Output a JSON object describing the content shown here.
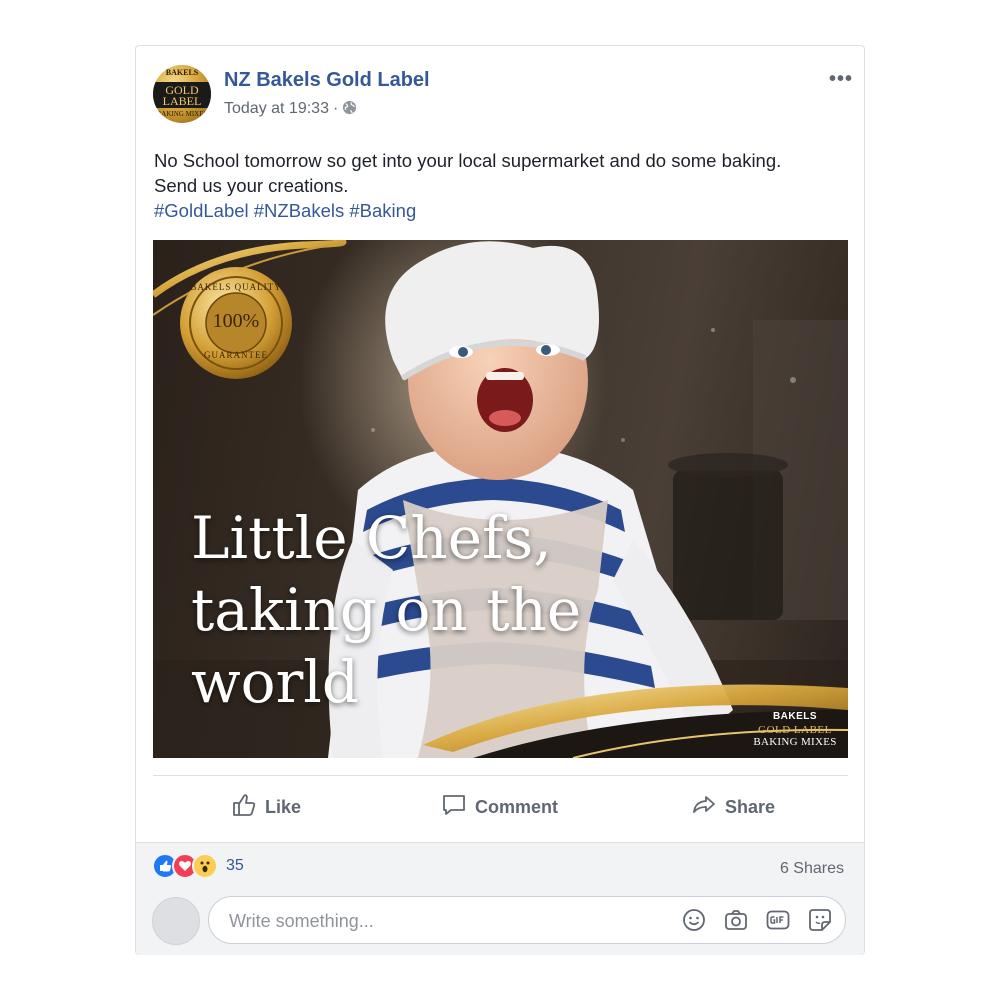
{
  "post": {
    "page_name": "NZ Bakels Gold Label",
    "timestamp": "Today at 19:33",
    "separator": "·",
    "privacy_icon": "globe-icon",
    "more_label": "•••",
    "text_line1": "No School tomorrow so get into your local supermarket and do some baking.",
    "text_line2": "Send us your creations.",
    "hashtags": "#GoldLabel #NZBakels #Baking",
    "avatar_logo": {
      "line1": "BAKELS",
      "line2": "GOLD",
      "line3": "LABEL",
      "line4": "BAKING MIXES"
    }
  },
  "photo": {
    "headline_line1": "Little Chefs,",
    "headline_line2": "taking on the",
    "headline_line3": "world",
    "badge_top": "BAKELS QUALITY",
    "badge_center": "100%",
    "badge_bottom": "GUARANTEE",
    "brand_line1": "BAKELS",
    "brand_line2": "GOLD LABEL",
    "brand_line3": "BAKING MIXES"
  },
  "actions": {
    "like_label": "Like",
    "comment_label": "Comment",
    "share_label": "Share"
  },
  "footer": {
    "reaction_icons": [
      "like-reaction-icon",
      "love-reaction-icon",
      "wow-reaction-icon"
    ],
    "reaction_count": "35",
    "shares_text": "6 Shares",
    "comment_placeholder": "Write something...",
    "composer_icons": [
      "emoji-icon",
      "camera-icon",
      "gif-icon",
      "sticker-icon"
    ]
  },
  "colors": {
    "link_blue": "#365899",
    "text_dark": "#1d2129",
    "text_gray": "#606770",
    "like_blue": "#2078f4",
    "love_red": "#f33e58",
    "wow_yellow": "#fbcd55",
    "gold": "#d6a53b"
  }
}
